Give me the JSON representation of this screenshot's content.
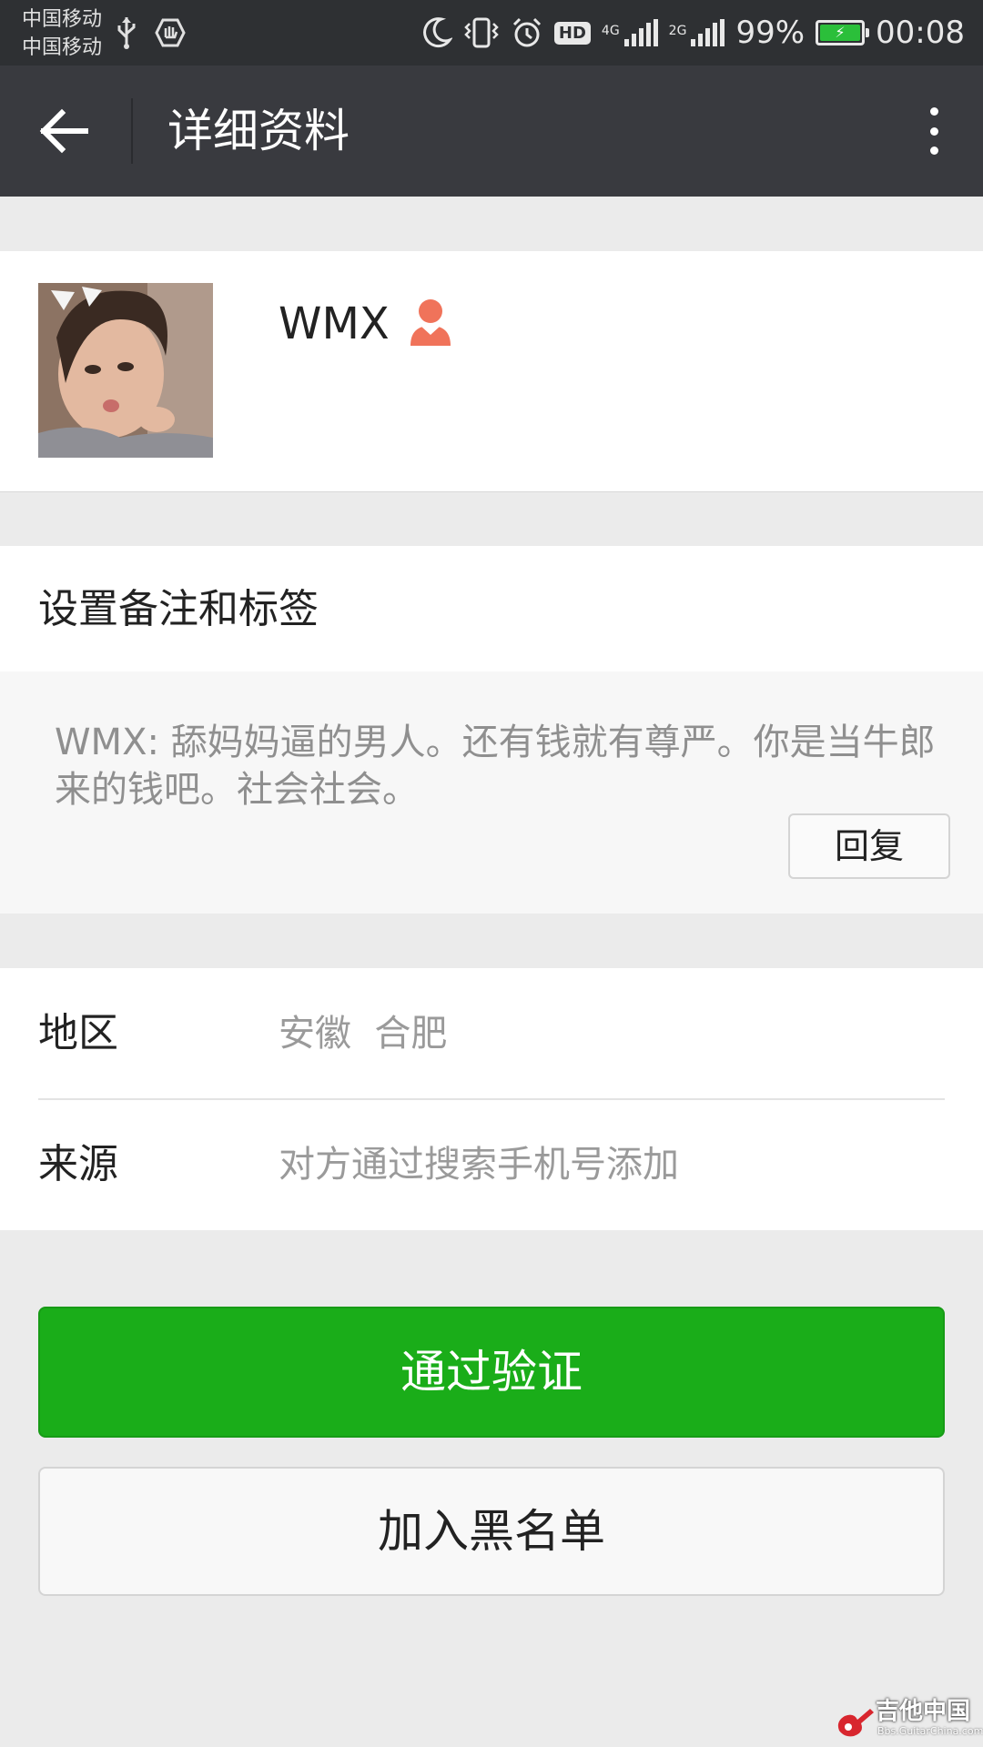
{
  "status_bar": {
    "carrier1": "中国移动",
    "carrier2": "中国移动",
    "sig1_tag": "4G",
    "sig2_tag": "2G",
    "hd_label": "HD",
    "battery_percent": "99%",
    "battery_level": 0.99,
    "time": "00:08",
    "icons": [
      "usb-icon",
      "security-icon",
      "moon-icon",
      "vibrate-icon",
      "alarm-icon",
      "hd-icon",
      "signal-icon",
      "signal-icon",
      "battery-charging-icon"
    ]
  },
  "titlebar": {
    "title": "详细资料",
    "back_icon": "arrow-left-icon",
    "more_icon": "more-vertical-icon"
  },
  "profile": {
    "name": "WMX",
    "gender_icon": "female-icon",
    "gender_color": "#f0735a"
  },
  "remark": {
    "title": "设置备注和标签",
    "comment": "WMX: 舔妈妈逼的男人。还有钱就有尊严。你是当牛郎来的钱吧。社会社会。",
    "reply_label": "回复"
  },
  "info_rows": [
    {
      "label": "地区",
      "value": "安徽  合肥"
    },
    {
      "label": "来源",
      "value": "对方通过搜索手机号添加"
    }
  ],
  "actions": {
    "accept_label": "通过验证",
    "blacklist_label": "加入黑名单",
    "accept_color": "#1aad19"
  },
  "watermark": {
    "name": "吉他中国",
    "url": "Bbs.GuitarChina.com"
  }
}
